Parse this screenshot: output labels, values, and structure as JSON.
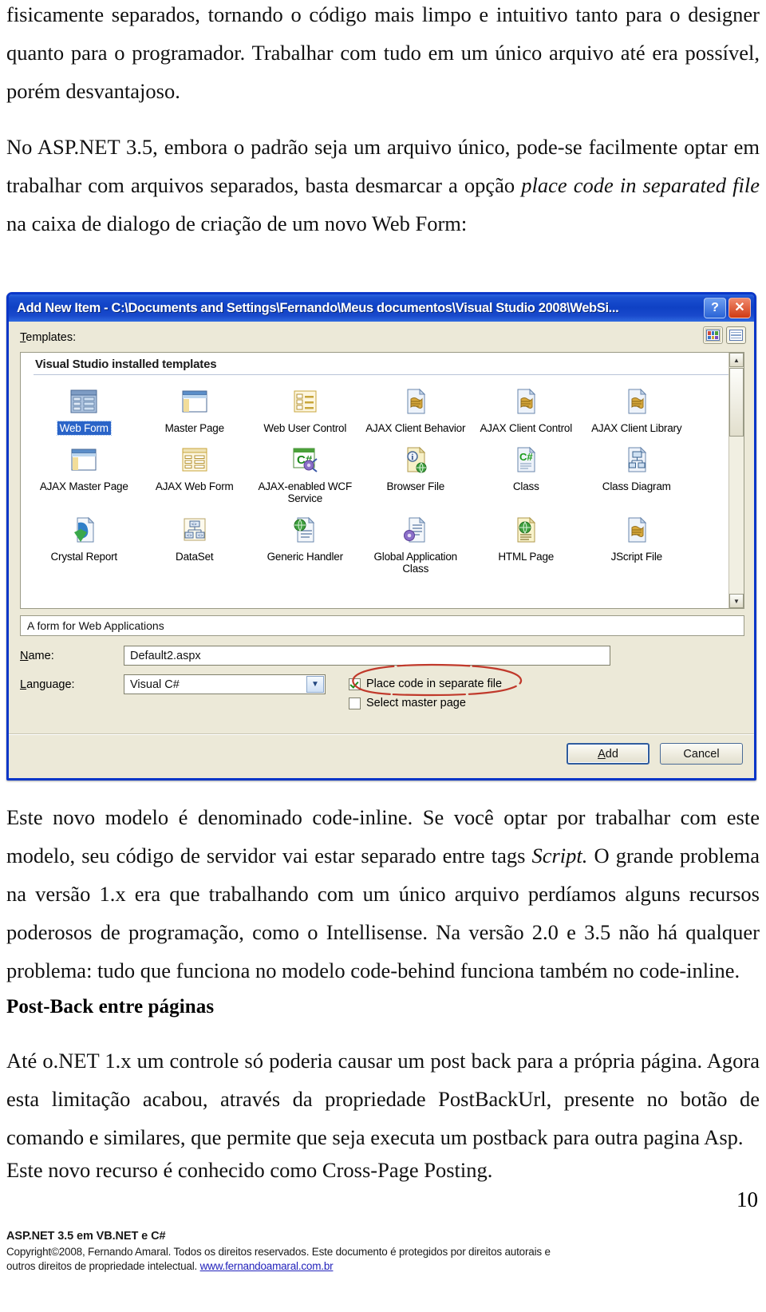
{
  "document": {
    "paragraph_top": "fisicamente separados,  tornando o código mais limpo e intuitivo tanto para o designer quanto para o programador. Trabalhar com tudo em um único arquivo até era possível, porém desvantajoso.",
    "paragraph_two_part1": "No ASP.NET 3.5, embora o padrão seja um arquivo único, pode-se facilmente optar em trabalhar com arquivos separados, basta desmarcar a opção ",
    "paragraph_two_italic": "place code in separated file",
    "paragraph_two_part2": " na caixa de dialogo de criação de um novo Web Form:",
    "paragraph_three_part1": "Este novo modelo é denominado code-inline. Se você optar por trabalhar com este modelo, seu código de servidor vai estar separado entre tags ",
    "paragraph_three_italic": "Script.",
    "paragraph_three_part2": " O grande problema na versão 1.x era que trabalhando com um único arquivo perdíamos alguns recursos poderosos de programação, como o Intellisense. Na versão 2.0 e 3.5 não há qualquer problema: tudo que funciona no modelo code-behind funciona também no code-inline.",
    "heading_postback": "Post-Back entre páginas",
    "paragraph_four": "Até o.NET 1.x um controle só poderia causar um post back para a própria página. Agora esta limitação acabou, através da propriedade PostBackUrl, presente no botão de comando e similares, que permite que seja executa um postback para outra pagina Asp.",
    "paragraph_five": "Este novo recurso é conhecido como Cross-Page Posting.",
    "page_number": "10"
  },
  "footer": {
    "title": "ASP.NET 3.5 em VB.NET e C#",
    "copyright_line1": "Copyright©2008,  Fernando Amaral. Todos os direitos reservados. Este documento é protegidos por direitos autorais e",
    "copyright_line2": "outros direitos de propriedade intelectual. ",
    "website": "www.fernandoamaral.com.br"
  },
  "dialog": {
    "title": "Add New Item - C:\\Documents and Settings\\Fernando\\Meus documentos\\Visual Studio 2008\\WebSi...",
    "help_button": "?",
    "close_button": "✕",
    "view_buttons": [
      {
        "name": "large-icons-view",
        "active": true
      },
      {
        "name": "list-view",
        "active": false
      }
    ],
    "templates_label": "Templates:",
    "group_header": "Visual Studio installed templates",
    "templates": [
      {
        "label": "Web Form",
        "icon": "web-form-icon",
        "selected": true
      },
      {
        "label": "Master Page",
        "icon": "master-page-icon",
        "selected": false
      },
      {
        "label": "Web User Control",
        "icon": "web-user-control-icon",
        "selected": false
      },
      {
        "label": "AJAX Client Behavior",
        "icon": "script-file-icon",
        "selected": false
      },
      {
        "label": "AJAX Client Control",
        "icon": "script-file-icon",
        "selected": false
      },
      {
        "label": "AJAX Client Library",
        "icon": "script-file-icon",
        "selected": false
      },
      {
        "label": "AJAX Master Page",
        "icon": "master-page-icon",
        "selected": false
      },
      {
        "label": "AJAX Web Form",
        "icon": "web-form-icon",
        "selected": false
      },
      {
        "label": "AJAX-enabled WCF Service",
        "icon": "wcf-service-icon",
        "selected": false
      },
      {
        "label": "Browser File",
        "icon": "browser-file-icon",
        "selected": false
      },
      {
        "label": "Class",
        "icon": "class-icon",
        "selected": false
      },
      {
        "label": "Class Diagram",
        "icon": "class-diagram-icon",
        "selected": false
      },
      {
        "label": "Crystal Report",
        "icon": "crystal-report-icon",
        "selected": false
      },
      {
        "label": "DataSet",
        "icon": "dataset-icon",
        "selected": false
      },
      {
        "label": "Generic Handler",
        "icon": "generic-handler-icon",
        "selected": false
      },
      {
        "label": "Global Application Class",
        "icon": "global-app-class-icon",
        "selected": false
      },
      {
        "label": "HTML Page",
        "icon": "html-page-icon",
        "selected": false
      },
      {
        "label": "JScript File",
        "icon": "script-file-icon",
        "selected": false
      }
    ],
    "description": "A form for Web Applications",
    "name_label": "Name:",
    "name_value": "Default2.aspx",
    "language_label": "Language:",
    "language_value": "Visual C#",
    "checkbox_place_code": {
      "label": "Place code in separate file",
      "checked": true
    },
    "checkbox_select_master": {
      "label": "Select master page",
      "checked": false
    },
    "add_button": "Add",
    "cancel_button": "Cancel",
    "annotation_color": "#c0392b",
    "selection_color": "#2a64c8",
    "titlebar_color": "#0f41c4"
  }
}
